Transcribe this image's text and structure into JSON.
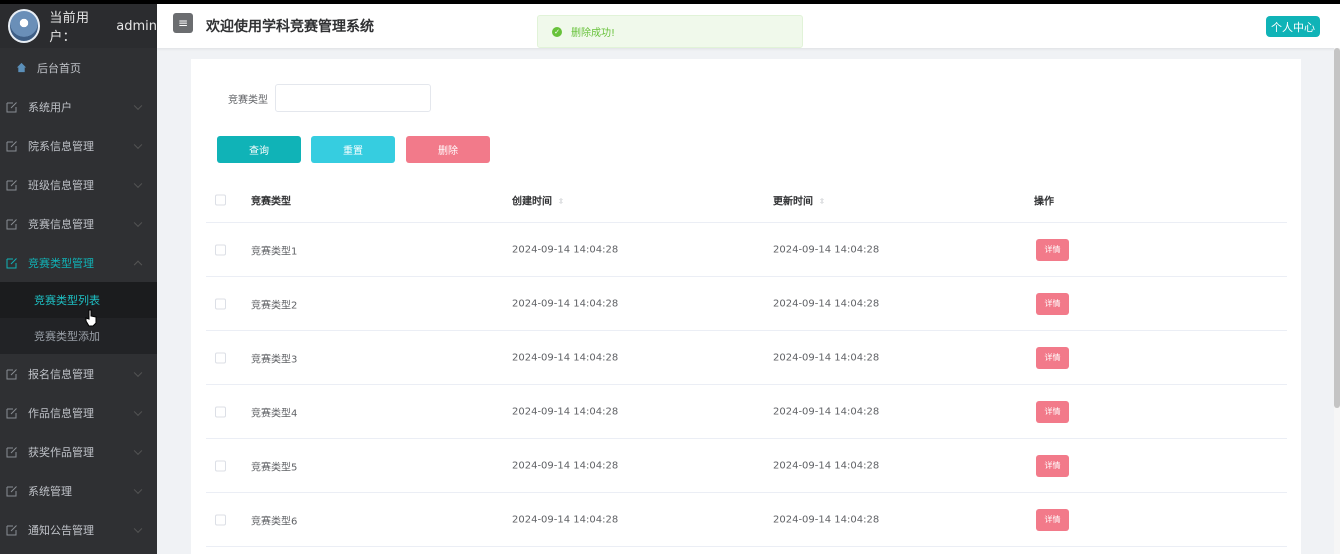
{
  "sidebar": {
    "user_label": "当前用户：",
    "user_name": "admin",
    "home": "后台首页",
    "items": [
      {
        "label": "系统用户"
      },
      {
        "label": "院系信息管理"
      },
      {
        "label": "班级信息管理"
      },
      {
        "label": "竞赛信息管理"
      },
      {
        "label": "竞赛类型管理",
        "expanded": true,
        "active": true
      },
      {
        "label": "报名信息管理"
      },
      {
        "label": "作品信息管理"
      },
      {
        "label": "获奖作品管理"
      },
      {
        "label": "系统管理"
      },
      {
        "label": "通知公告管理"
      }
    ],
    "submenu": [
      {
        "label": "竞赛类型列表",
        "active": true
      },
      {
        "label": "竞赛类型添加"
      }
    ]
  },
  "header": {
    "menu_icon": "≡",
    "title": "欢迎使用学科竞赛管理系统",
    "toast": "删除成功!",
    "profile_button": "个人中心"
  },
  "filter": {
    "label": "竞赛类型",
    "value": "",
    "placeholder": ""
  },
  "buttons": {
    "query": "查询",
    "reset": "重置",
    "delete": "删除"
  },
  "table": {
    "columns": {
      "type": "竞赛类型",
      "created": "创建时间",
      "updated": "更新时间",
      "operation": "操作"
    },
    "detail_label": "详情",
    "rows": [
      {
        "type": "竞赛类型1",
        "created": "2024-09-14 14:04:28",
        "updated": "2024-09-14 14:04:28"
      },
      {
        "type": "竞赛类型2",
        "created": "2024-09-14 14:04:28",
        "updated": "2024-09-14 14:04:28"
      },
      {
        "type": "竞赛类型3",
        "created": "2024-09-14 14:04:28",
        "updated": "2024-09-14 14:04:28"
      },
      {
        "type": "竞赛类型4",
        "created": "2024-09-14 14:04:28",
        "updated": "2024-09-14 14:04:28"
      },
      {
        "type": "竞赛类型5",
        "created": "2024-09-14 14:04:28",
        "updated": "2024-09-14 14:04:28"
      },
      {
        "type": "竞赛类型6",
        "created": "2024-09-14 14:04:28",
        "updated": "2024-09-14 14:04:28"
      }
    ]
  },
  "colors": {
    "accent": "#10b3b7",
    "reset": "#36cde0",
    "danger": "#f27a8a",
    "sidebar_bg": "#2f3033",
    "success": "#67c23a"
  }
}
